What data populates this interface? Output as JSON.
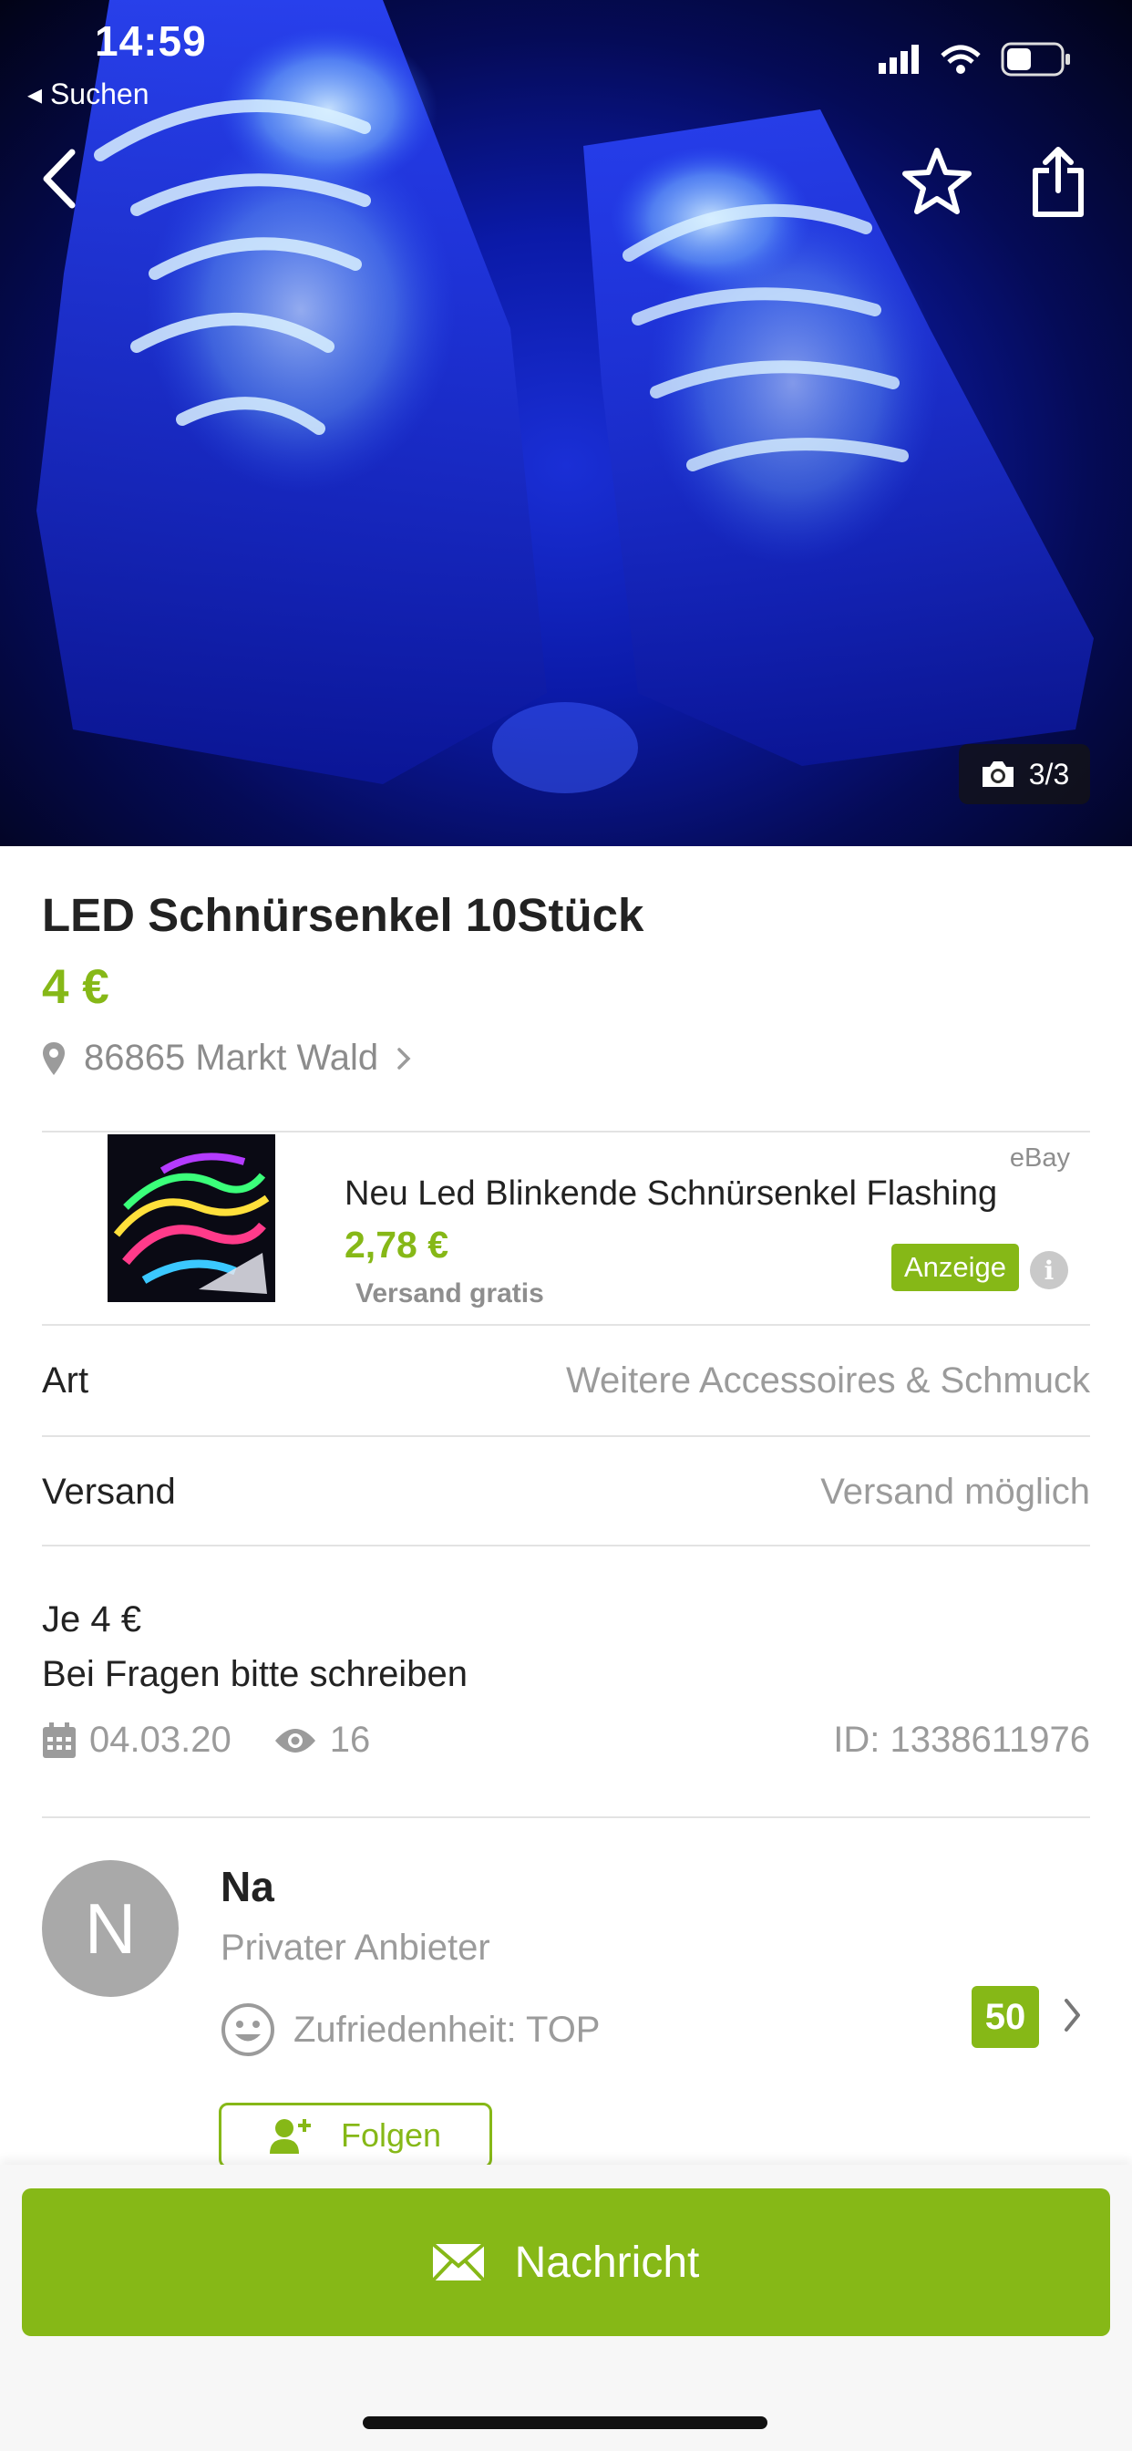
{
  "status_bar": {
    "time": "14:59",
    "back_app": "◂ Suchen"
  },
  "hero": {
    "photo_counter": "3/3"
  },
  "listing": {
    "title": "LED Schnürsenkel 10Stück",
    "price": "4 €",
    "location": "86865 Markt Wald"
  },
  "ad": {
    "source": "eBay",
    "title": "Neu Led Blinkende Schnürsenkel Flashing",
    "price": "2,78 €",
    "shipping": "Versand gratis",
    "badge": "Anzeige",
    "info": "i"
  },
  "details": [
    {
      "label": "Art",
      "value": "Weitere Accessoires & Schmuck"
    },
    {
      "label": "Versand",
      "value": "Versand möglich"
    }
  ],
  "description": {
    "line1": "Je 4 €",
    "line2": "Bei Fragen bitte schreiben"
  },
  "meta": {
    "date": "04.03.20",
    "views": "16",
    "id": "ID: 1338611976"
  },
  "seller": {
    "initial": "N",
    "name": "Na",
    "type": "Privater Anbieter",
    "satisfaction": "Zufriedenheit: TOP",
    "score": "50",
    "follow_label": "Folgen"
  },
  "actions": {
    "message_label": "Nachricht"
  },
  "colors": {
    "accent": "#86b817",
    "muted": "#9b9b9b"
  }
}
